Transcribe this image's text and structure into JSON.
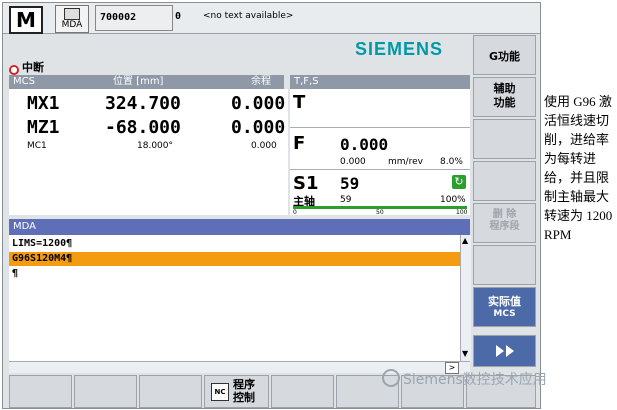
{
  "topbar": {
    "logo": "M",
    "mode": "MDA",
    "program": "700002",
    "channel": "0",
    "message": "<no text available>"
  },
  "brand": "SIEMENS",
  "status": {
    "icon": "stop-icon",
    "text": "中断"
  },
  "position": {
    "header_mcs": "MCS",
    "header_pos": "位置 [mm]",
    "header_rest": "余程",
    "axes": [
      {
        "name": "MX1",
        "value": "324.700",
        "rest": "0.000"
      },
      {
        "name": "MZ1",
        "value": "-68.000",
        "rest": "0.000"
      },
      {
        "name": "MC1",
        "value": "18.000°",
        "rest": "0.000"
      }
    ]
  },
  "tfs": {
    "header": "T,F,S",
    "t_label": "T",
    "f_label": "F",
    "f_value": "0.000",
    "f_actual": "0.000",
    "f_unit": "mm/rev",
    "f_override": "8.0%",
    "s_label": "S1",
    "s_value": "59",
    "spindle_label": "主轴",
    "spindle_value": "59",
    "spindle_override": "100%",
    "scale_0": "0",
    "scale_50": "50",
    "scale_100": "100",
    "spindle_level_percent": 100
  },
  "mda": {
    "header": "MDA",
    "lines": [
      "LIMS=1200¶",
      "G96S120M4¶",
      "¶"
    ],
    "selected_line": 1
  },
  "softkeys": {
    "g_function": "G功能",
    "aux_function": "辅助\n功能",
    "delete_block": "删 除\n程序段",
    "actual_value": "实际值",
    "actual_value_sub": "MCS"
  },
  "bottom": {
    "program_control": "程序\n控制",
    "nc_icon": "NC"
  },
  "annotation": "使用 G96 激活恒线速切削，进给率为每转进给，并且限制主轴最大转速为 1200RPM",
  "watermark": "Siemens数控技术应用",
  "colors": {
    "brand": "#009aa6",
    "selection": "#f39c12",
    "mda_header": "#5f6fb7",
    "softkey_active": "#4c69a8"
  }
}
